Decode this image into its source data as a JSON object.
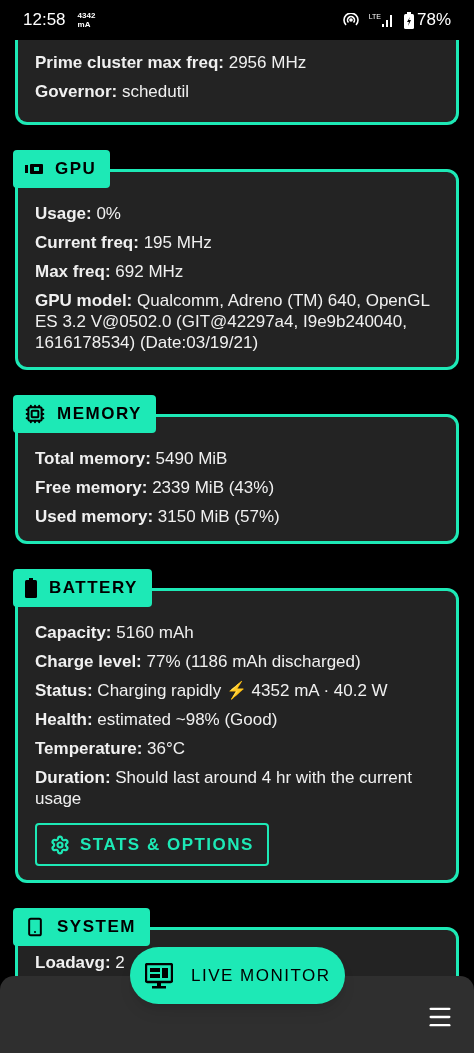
{
  "status_bar": {
    "time": "12:58",
    "current_value": "4342",
    "current_unit": "mA",
    "network": "LTE",
    "battery": "78%"
  },
  "sections": [
    {
      "kind": "partial",
      "rows": [
        "**Prime cluster max freq:** 2956 MHz",
        "**Governor:** schedutil"
      ]
    },
    {
      "kind": "gpu",
      "title": "GPU",
      "rows": [
        "**Usage:** 0%",
        "**Current freq:** 195 MHz",
        "**Max freq:** 692 MHz",
        "**GPU model:** Qualcomm, Adreno (TM) 640, OpenGL ES 3.2 V@0502.0 (GIT@42297a4, I9e9b240040, 1616178534) (Date:03/19/21)"
      ]
    },
    {
      "kind": "memory",
      "title": "MEMORY",
      "rows": [
        "**Total memory:** 5490 MiB",
        "**Free memory:** 2339 MiB (43%)",
        "**Used memory:** 3150 MiB (57%)"
      ]
    },
    {
      "kind": "battery",
      "title": "BATTERY",
      "rows": [
        "**Capacity:** 5160 mAh",
        "**Charge level:** 77% (1186 mAh discharged)",
        "**Status:** Charging rapidly ⚡ 4352 mA · 40.2 W",
        "**Health:** estimated ~98% (Good)",
        "**Temperature:** 36°C",
        "**Duration:** Should last around 4 hr with the current usage"
      ],
      "button": "STATS & OPTIONS"
    },
    {
      "kind": "system",
      "title": "SYSTEM",
      "rows": [
        "**Loadavg:** 2"
      ]
    }
  ],
  "fab": {
    "label": "LIVE MONITOR"
  }
}
